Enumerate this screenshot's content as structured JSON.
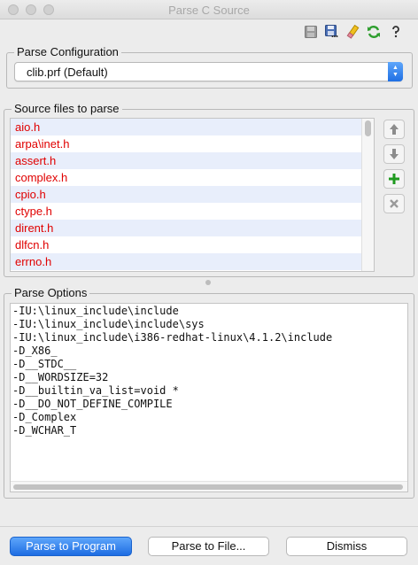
{
  "window": {
    "title": "Parse C Source"
  },
  "toolbar": {
    "icons": [
      "save-disabled-icon",
      "save-as-icon",
      "clear-icon",
      "refresh-icon"
    ],
    "colors": {
      "refresh": "#2e9e2e",
      "clear": "#f0c020"
    }
  },
  "parse_configuration": {
    "legend": "Parse Configuration",
    "selected": "clib.prf (Default)"
  },
  "source_files": {
    "legend": "Source files to parse",
    "files": [
      "aio.h",
      "arpa\\inet.h",
      "assert.h",
      "complex.h",
      "cpio.h",
      "ctype.h",
      "dirent.h",
      "dlfcn.h",
      "errno.h"
    ],
    "file_color": "#e00000",
    "side_buttons": [
      "move-up-icon",
      "move-down-icon",
      "add-icon",
      "remove-icon"
    ]
  },
  "parse_options": {
    "legend": "Parse Options",
    "text": "-IU:\\linux_include\\include\n-IU:\\linux_include\\include\\sys\n-IU:\\linux_include\\i386-redhat-linux\\4.1.2\\include\n-D_X86_\n-D__STDC__\n-D__WORDSIZE=32\n-D__builtin_va_list=void *\n-D__DO_NOT_DEFINE_COMPILE\n-D_Complex\n-D_WCHAR_T"
  },
  "buttons": {
    "parse_to_program": "Parse to Program",
    "parse_to_file": "Parse to File...",
    "dismiss": "Dismiss"
  },
  "accent": "#1e6de2"
}
